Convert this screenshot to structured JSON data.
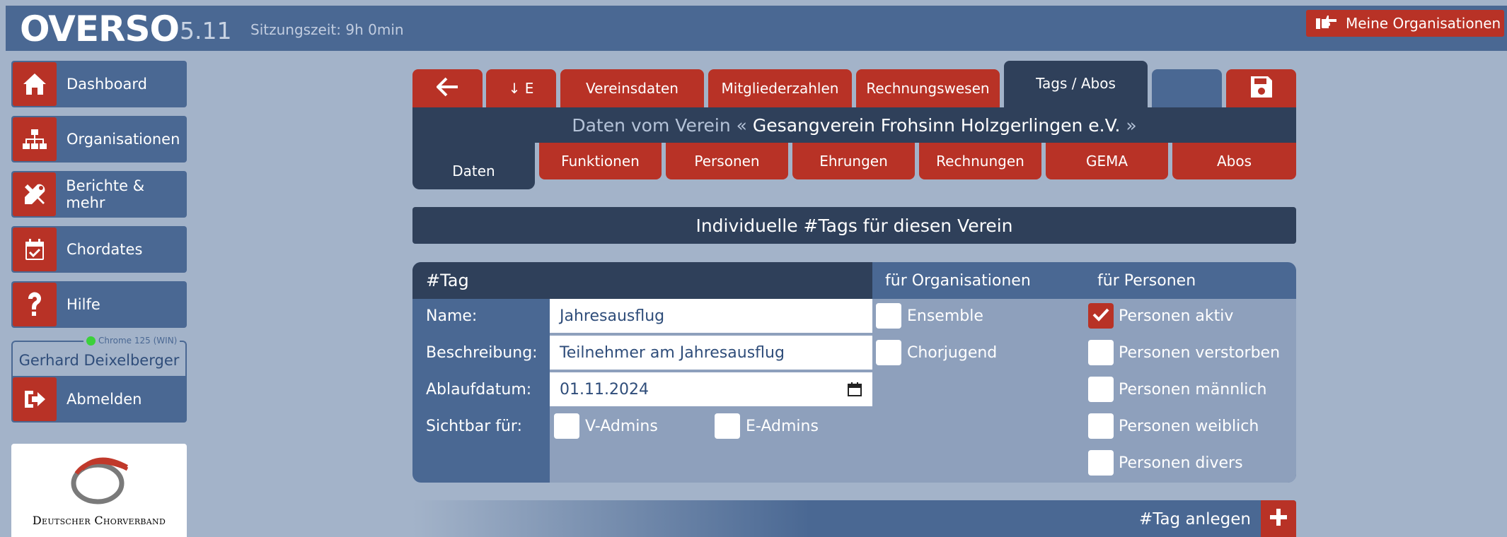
{
  "app": {
    "logo": "OVERSO",
    "version": "5.11",
    "session": "Sitzungszeit: 9h 0min",
    "meine_org": "Meine Organisationen"
  },
  "sidebar": {
    "items": [
      {
        "label": "Dashboard",
        "icon": "home-icon"
      },
      {
        "label": "Organisationen",
        "icon": "org-chart-icon"
      },
      {
        "label": "Berichte & mehr",
        "icon": "tools-icon"
      },
      {
        "label": "Chordates",
        "icon": "calendar-check-icon"
      },
      {
        "label": "Hilfe",
        "icon": "question-icon"
      }
    ],
    "browser": "Chrome 125 (WIN)",
    "user": "Gerhard Deixelberger",
    "logout": "Abmelden",
    "logo_text": "Deutscher Chorverband"
  },
  "tabs": {
    "back": "←",
    "down_e": "↓ E",
    "vereinsdaten": "Vereinsdaten",
    "mitglieder": "Mitgliederzahlen",
    "rechnungswesen": "Rechnungswesen",
    "tags": "Tags / Abos"
  },
  "title": {
    "prefix": "Daten vom Verein «",
    "name": " Gesangverein Frohsinn Holzgerlingen e.V. ",
    "suffix": "»"
  },
  "subtabs": {
    "daten": "Daten",
    "funktionen": "Funktionen",
    "personen": "Personen",
    "ehrungen": "Ehrungen",
    "rechnungen": "Rechnungen",
    "gema": "GEMA",
    "abos": "Abos"
  },
  "section_header": "Individuelle #Tags für diesen Verein",
  "form": {
    "tag_header": "#Tag",
    "org_header": "für Organisationen",
    "pers_header": "für Personen",
    "name_label": "Name:",
    "name_value": "Jahresausflug",
    "desc_label": "Beschreibung:",
    "desc_value": "Teilnehmer am Jahresausflug",
    "date_label": "Ablaufdatum:",
    "date_value": "01.11.2024",
    "visible_label": "Sichtbar für:",
    "v_admins": "V-Admins",
    "e_admins": "E-Admins",
    "org_options": [
      {
        "label": "Ensemble",
        "checked": false
      },
      {
        "label": "Chorjugend",
        "checked": false
      }
    ],
    "pers_options": [
      {
        "label": "Personen aktiv",
        "checked": true
      },
      {
        "label": "Personen verstorben",
        "checked": false
      },
      {
        "label": "Personen männlich",
        "checked": false
      },
      {
        "label": "Personen weiblich",
        "checked": false
      },
      {
        "label": "Personen divers",
        "checked": false
      }
    ]
  },
  "add_tag": "#Tag anlegen",
  "colors": {
    "brand": "#4a6893",
    "accent": "#b83226",
    "navy": "#2f405a",
    "bg": "#a3b3c9"
  }
}
